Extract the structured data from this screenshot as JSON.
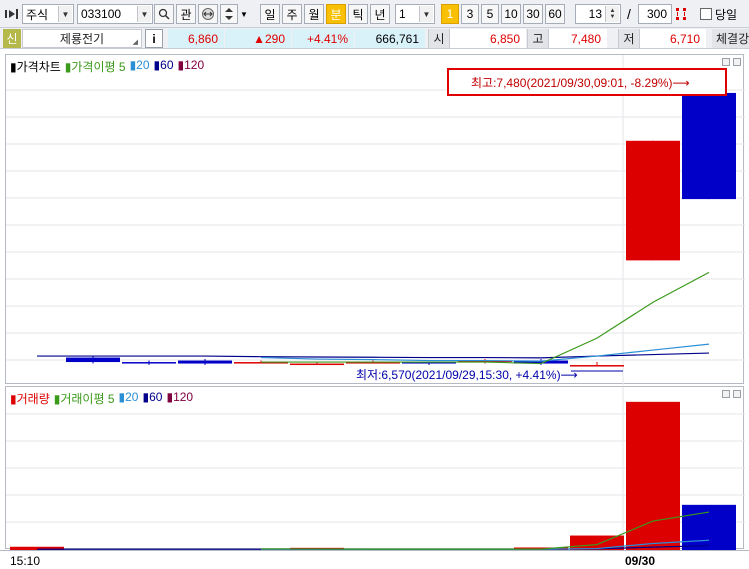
{
  "toolbar": {
    "market": "주식",
    "code": "033100",
    "btn_gwan": "관",
    "periods": [
      "일",
      "주",
      "월",
      "분",
      "틱",
      "년"
    ],
    "active_period": "분",
    "interval_value": "1",
    "minute_options": [
      "1",
      "3",
      "5",
      "10",
      "30",
      "60"
    ],
    "active_minute": "1",
    "page_current": "13",
    "page_separator": "/",
    "page_total": "300",
    "today_label": "당일"
  },
  "info": {
    "badge": "신",
    "name": "제룡전기",
    "info_btn": "i",
    "price": "6,860",
    "change": "▲290",
    "change_pct": "+4.41%",
    "volume": "666,761",
    "open_label": "시",
    "open": "6,850",
    "high_label": "고",
    "high": "7,480",
    "low_label": "저",
    "low": "6,710",
    "trade_label": "체결강"
  },
  "price_pane": {
    "legend": [
      "가격차트",
      "가격이평 5",
      "20",
      "60",
      "120"
    ],
    "high_annotation": "최고:7,480(2021/09/30,09:01, -8.29%)⟶",
    "low_annotation": "최저:6,570(2021/09/29,15:30, +4.41%)⟶"
  },
  "volume_pane": {
    "legend": [
      "거래량",
      "거래이평 5",
      "20",
      "60",
      "120"
    ]
  },
  "xaxis": {
    "labels": [
      "15:10",
      "09/30"
    ]
  },
  "colors": {
    "up": "#dd0000",
    "down": "#0000c8",
    "ma5": "#3a9a1a",
    "ma20": "#2b8fd6",
    "ma60": "#00008b",
    "ma120": "#800040",
    "accent": "#f8c000"
  },
  "chart_data": {
    "type": "candlestick",
    "series": [
      {
        "name": "가격차트",
        "candles": [
          {
            "open": 6595,
            "close": 6580,
            "high": 6600,
            "low": 6575
          },
          {
            "open": 6580,
            "close": 6575,
            "high": 6585,
            "low": 6570
          },
          {
            "open": 6585,
            "close": 6575,
            "high": 6590,
            "low": 6570
          },
          {
            "open": 6580,
            "close": 6580,
            "high": 6585,
            "low": 6575
          },
          {
            "open": 6575,
            "close": 6575,
            "high": 6580,
            "low": 6570
          },
          {
            "open": 6580,
            "close": 6580,
            "high": 6585,
            "low": 6575
          },
          {
            "open": 6580,
            "close": 6575,
            "high": 6580,
            "low": 6570
          },
          {
            "open": 6580,
            "close": 6585,
            "high": 6590,
            "low": 6575
          },
          {
            "open": 6585,
            "close": 6575,
            "high": 6590,
            "low": 6570
          },
          {
            "open": 6570,
            "close": 6570,
            "high": 6580,
            "low": 6570
          },
          {
            "open": 6920,
            "close": 7320,
            "high": 7320,
            "low": 6920
          },
          {
            "open": 7480,
            "close": 7125,
            "high": 7480,
            "low": 7125
          }
        ]
      }
    ],
    "volumes": [
      900,
      0,
      0,
      0,
      0,
      600,
      0,
      0,
      0,
      700,
      4000,
      41000,
      12500
    ],
    "ma": {
      "price_ma5": [
        null,
        null,
        null,
        null,
        6580,
        6580,
        6580,
        6580,
        6580,
        6575,
        6660,
        6780,
        6880
      ],
      "price_ma20": [
        null,
        null,
        null,
        null,
        6595,
        6590,
        6588,
        6585,
        6585,
        6583,
        6600,
        6620,
        6640
      ],
      "price_ma60": [
        6600,
        6600,
        6600,
        6600,
        6598,
        6597,
        6596,
        6595,
        6595,
        6594,
        6600,
        6605,
        6610
      ],
      "vol_ma5": [
        null,
        null,
        null,
        null,
        300,
        300,
        250,
        250,
        250,
        250,
        1500,
        8000,
        10500
      ],
      "vol_ma20": [
        null,
        null,
        null,
        null,
        200,
        200,
        200,
        200,
        200,
        200,
        400,
        1800,
        2700
      ],
      "vol_ma60": [
        200,
        200,
        200,
        200,
        200,
        200,
        200,
        200,
        200,
        200,
        300,
        800,
        1200
      ]
    },
    "price_range": [
      6530,
      7540
    ],
    "volume_range": [
      0,
      44000
    ]
  }
}
